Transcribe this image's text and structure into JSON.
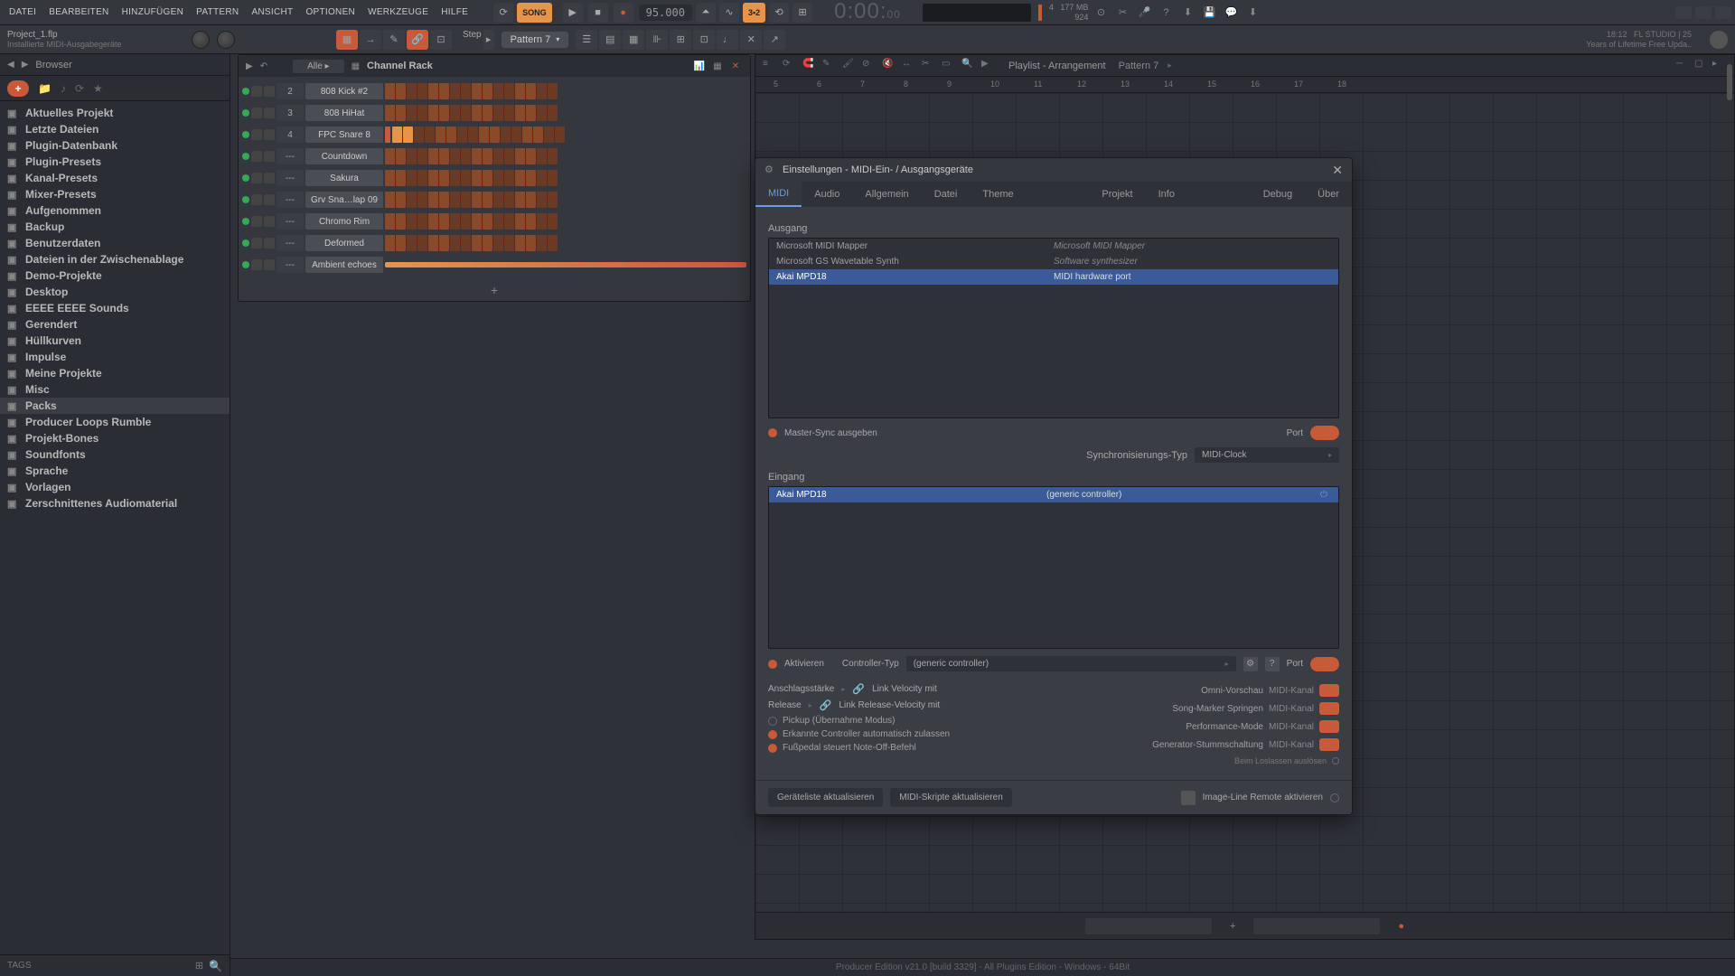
{
  "menubar": [
    "DATEI",
    "BEARBEITEN",
    "HINZUFüGEN",
    "PATTERN",
    "ANSICHT",
    "OPTIONEN",
    "WERKZEUGE",
    "HILFE"
  ],
  "song_btn": "SONG",
  "tempo": "95.000",
  "time": "0:00:",
  "time_ms": "00",
  "cpu": "4",
  "mem": "177 MB",
  "poly": "924",
  "project": {
    "title": "Project_1.flp",
    "sub": "Installierte MIDI-Ausgabegeräte"
  },
  "step_label": "Step",
  "pattern_selector": "Pattern 7",
  "fl_info": {
    "time": "18:12",
    "name": "FL STUDIO | 25",
    "sub": "Years of Lifetime Free Upda.."
  },
  "browser": {
    "title": "Browser",
    "items": [
      "Aktuelles Projekt",
      "Letzte Dateien",
      "Plugin-Datenbank",
      "Plugin-Presets",
      "Kanal-Presets",
      "Mixer-Presets",
      "Aufgenommen",
      "Backup",
      "Benutzerdaten",
      "Dateien in der Zwischenablage",
      "Demo-Projekte",
      "Desktop",
      "EEEE EEEE Sounds",
      "Gerendert",
      "Hüllkurven",
      "Impulse",
      "Meine Projekte",
      "Misc",
      "Packs",
      "Producer Loops Rumble",
      "Projekt-Bones",
      "Soundfonts",
      "Sprache",
      "Vorlagen",
      "Zerschnittenes Audiomaterial"
    ],
    "active_index": 18,
    "tags": "TAGS"
  },
  "channel_rack": {
    "title": "Channel Rack",
    "filter": "Alle",
    "channels": [
      {
        "num": "2",
        "name": "808 Kick #2"
      },
      {
        "num": "3",
        "name": "808 HiHat"
      },
      {
        "num": "4",
        "name": "FPC Snare 8"
      },
      {
        "num": "---",
        "name": "Countdown"
      },
      {
        "num": "---",
        "name": "Sakura"
      },
      {
        "num": "---",
        "name": "Grv Sna…lap 09"
      },
      {
        "num": "---",
        "name": "Chromo Rim"
      },
      {
        "num": "---",
        "name": "Deformed"
      },
      {
        "num": "---",
        "name": "Ambient echoes"
      }
    ]
  },
  "playlist": {
    "title": "Playlist - Arrangement",
    "pattern": "Pattern 7",
    "ruler": [
      "5",
      "6",
      "7",
      "8",
      "9",
      "10",
      "11",
      "12",
      "13",
      "14",
      "15",
      "16",
      "17",
      "18"
    ]
  },
  "dialog": {
    "title": "Einstellungen - MIDI-Ein- / Ausgangsgeräte",
    "tabs": [
      "MIDI",
      "Audio",
      "Allgemein",
      "Datei",
      "Theme",
      "Projekt",
      "Info",
      "Debug",
      "Über"
    ],
    "output_label": "Ausgang",
    "output_devices": [
      {
        "name": "Microsoft MIDI Mapper",
        "type": "Microsoft MIDI Mapper",
        "selected": false
      },
      {
        "name": "Microsoft GS Wavetable Synth",
        "type": "Software synthesizer",
        "selected": false
      },
      {
        "name": "Akai MPD18",
        "type": "MIDI hardware port",
        "selected": true
      }
    ],
    "master_sync": "Master-Sync ausgeben",
    "port_label": "Port",
    "sync_type_label": "Synchronisierungs-Typ",
    "sync_type_value": "MIDI-Clock",
    "input_label": "Eingang",
    "input_devices": [
      {
        "name": "Akai MPD18",
        "type": "(generic controller)",
        "selected": true,
        "power": true
      }
    ],
    "activate": "Aktivieren",
    "controller_type_label": "Controller-Typ",
    "controller_type_value": "(generic controller)",
    "velocity_label": "Anschlagsstärke",
    "link_velocity": "Link Velocity mit",
    "release_label": "Release",
    "link_release": "Link Release-Velocity mit",
    "pickup": "Pickup (Übernahme Modus)",
    "auto_accept": "Erkannte Controller automatisch zulassen",
    "foot_pedal": "Fußpedal steuert Note-Off-Befehl",
    "omni_preview": "Omni-Vorschau",
    "song_marker": "Song-Marker Springen",
    "performance": "Performance-Mode",
    "gen_mute": "Generator-Stummschaltung",
    "midi_channel": "MIDI-Kanal",
    "release_trigger": "Beim Loslassen auslösen",
    "refresh_devices": "Geräteliste aktualisieren",
    "refresh_scripts": "MIDI-Skripte aktualisieren",
    "enable_remote": "Image-Line Remote aktivieren"
  },
  "status": "Producer Edition v21.0 [build 3329] - All Plugins Edition - Windows - 64Bit"
}
